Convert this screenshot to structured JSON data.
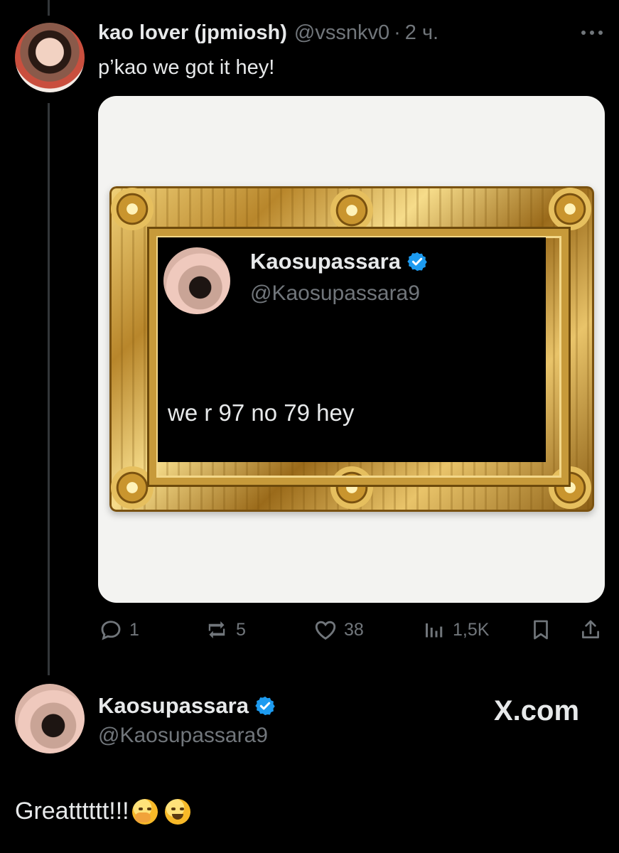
{
  "post": {
    "author_name": "kao lover (jpmiosh)",
    "handle": "@vssnkv0",
    "separator": "·",
    "time": "2 ч.",
    "text": "p’kao we got it hey!",
    "more_icon": "more-horizontal-icon",
    "avatar": "user-avatar"
  },
  "embedded_post": {
    "author_name": "Kaosupassara",
    "handle": "@Kaosupassara9",
    "verified": true,
    "verified_color": "#1d9bf0",
    "text": "we r 97 no 79 hey"
  },
  "actions": {
    "reply_count": "1",
    "repost_count": "5",
    "like_count": "38",
    "views_count": "1,5K",
    "icons": [
      "reply-icon",
      "repost-icon",
      "like-icon",
      "views-icon",
      "bookmark-icon",
      "share-icon"
    ]
  },
  "reply": {
    "author_name": "Kaosupassara",
    "handle": "@Kaosupassara9",
    "verified": true,
    "text": "Greatttttt!!!",
    "emojis": [
      "hand-over-mouth-emoji",
      "rolling-laughing-emoji"
    ]
  },
  "watermark": "X.com",
  "colors": {
    "background": "#000000",
    "text": "#e7e9ea",
    "muted": "#71767b",
    "verified": "#1d9bf0",
    "thread_line": "#333639"
  }
}
